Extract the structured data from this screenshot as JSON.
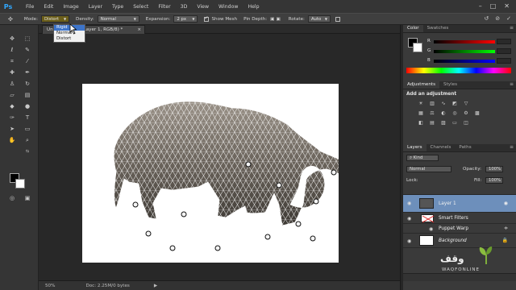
{
  "app": {
    "logo": "Ps"
  },
  "menubar": {
    "items": [
      "File",
      "Edit",
      "Image",
      "Layer",
      "Type",
      "Select",
      "Filter",
      "3D",
      "View",
      "Window",
      "Help"
    ]
  },
  "options": {
    "tool_icon": "puppet-warp-icon",
    "mode_label": "Mode:",
    "mode_value": "Distort",
    "density_label": "Density:",
    "density_value": "Normal",
    "expansion_label": "Expansion:",
    "expansion_value": "2 px",
    "show_mesh_label": "Show Mesh",
    "show_mesh_checked": true,
    "pin_depth_label": "Pin Depth:",
    "rotate_label": "Rotate:",
    "rotate_value": "Auto"
  },
  "mode_dropdown": {
    "options": [
      "Rigid",
      "Normal",
      "Distort"
    ],
    "highlighted": "Rigid"
  },
  "document_tab": {
    "prefix": "Unt",
    "suffix": "(Layer 1, RGB/8) *",
    "close": "×"
  },
  "statusbar": {
    "zoom": "50%",
    "doc_info": "Doc: 2.25M/0 bytes"
  },
  "color_panel": {
    "tabs": [
      "Color",
      "Swatches"
    ],
    "channels": [
      {
        "label": "R",
        "gradient": "#ff0000"
      },
      {
        "label": "G",
        "gradient": "#00ff00"
      },
      {
        "label": "B",
        "gradient": "#0000ff"
      }
    ]
  },
  "adjustments_panel": {
    "tabs": [
      "Adjustments",
      "Styles"
    ],
    "title": "Add an adjustment"
  },
  "layers_panel": {
    "tabs": [
      "Layers",
      "Channels",
      "Paths"
    ],
    "kind_label": "Kind",
    "blend_mode": "Normal",
    "opacity_label": "Opacity:",
    "opacity_value": "100%",
    "lock_label": "Lock:",
    "fill_label": "Fill:",
    "fill_value": "100%",
    "layers": [
      {
        "name": "Layer 1",
        "selected": true
      },
      {
        "name": "Smart Filters",
        "selected": false
      },
      {
        "name": "Puppet Warp",
        "selected": false
      },
      {
        "name": "Background",
        "selected": false
      }
    ]
  },
  "watermark": {
    "arabic": "وقف",
    "latin": "WAQFONLINE"
  },
  "colors": {
    "app_bg": "#2a2a2a",
    "panel_bg": "#3a3a3a",
    "selection_blue": "#6d8fbb",
    "mesh": "#ffffff",
    "logo_blue": "#31a8ff"
  }
}
